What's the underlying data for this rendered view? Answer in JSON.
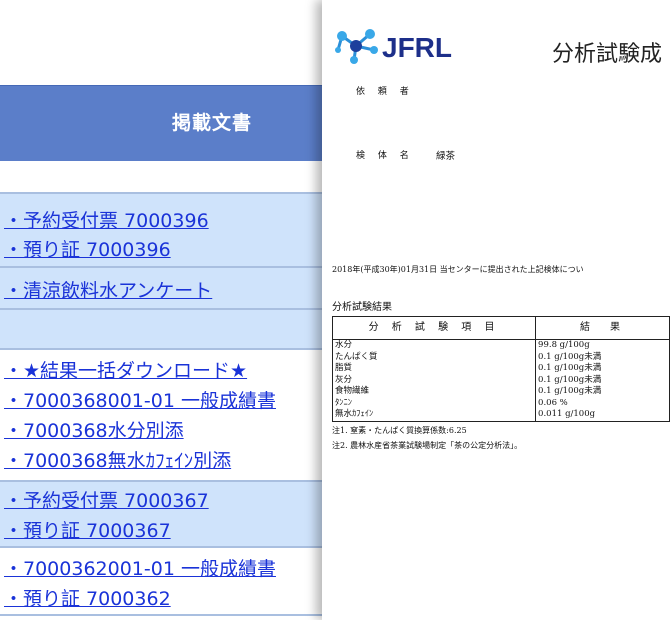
{
  "left_panel": {
    "header": "掲載文書",
    "rows": [
      {
        "links": []
      },
      {
        "links": [
          "・予約受付票  7000396",
          "・預り証  7000396"
        ]
      },
      {
        "links": [
          "・清涼飲料水アンケート"
        ]
      },
      {
        "links": []
      },
      {
        "links": [
          "・★結果一括ダウンロード★",
          "・7000368001-01  一般成績書",
          "・7000368水分別添",
          "・7000368無水ｶﾌｪｲﾝ別添"
        ]
      },
      {
        "links": [
          "・予約受付票  7000367",
          "・預り証  7000367"
        ]
      },
      {
        "links": [
          "・7000362001-01  一般成績書",
          "・預り証 7000362"
        ]
      }
    ]
  },
  "document": {
    "logo": "JFRL",
    "title": "分析試験成",
    "requester_label": "依 頼 者",
    "sample_label": "検 体 名",
    "sample_name": "緑茶",
    "date_text": "2018年(平成30年)01月31日 当センターに提出された上記検体につい",
    "results_heading": "分析試験結果",
    "table": {
      "headers": [
        "分 析 試 験 項 目",
        "結　果"
      ],
      "rows": [
        {
          "item": "水分",
          "result": "99.8 g/100g"
        },
        {
          "item": "たんぱく質",
          "result": "0.1 g/100g未満"
        },
        {
          "item": "脂質",
          "result": "0.1 g/100g未満"
        },
        {
          "item": "灰分",
          "result": "0.1 g/100g未満"
        },
        {
          "item": "食物繊維",
          "result": "0.1 g/100g未満"
        },
        {
          "item": "ﾀﾝﾆﾝ",
          "result": "0.06 %"
        },
        {
          "item": "無水ｶﾌｪｲﾝ",
          "result": "0.011 g/100g"
        }
      ]
    },
    "notes": [
      "注1. 窒素・たんぱく質換算係数:6.25",
      "注2. 農林水産省茶業試験場制定「茶の公定分析法」。"
    ]
  }
}
